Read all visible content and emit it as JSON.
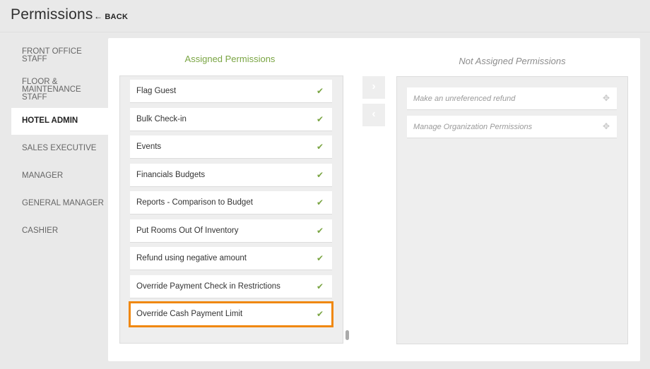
{
  "header": {
    "title": "Permissions",
    "back_label": "BACK"
  },
  "sidebar": {
    "items": [
      {
        "label": "FRONT OFFICE STAFF",
        "active": false
      },
      {
        "label": "FLOOR & MAINTENANCE STAFF",
        "active": false
      },
      {
        "label": "HOTEL ADMIN",
        "active": true
      },
      {
        "label": "SALES EXECUTIVE",
        "active": false
      },
      {
        "label": "MANAGER",
        "active": false
      },
      {
        "label": "GENERAL MANAGER",
        "active": false
      },
      {
        "label": "CASHIER",
        "active": false
      }
    ]
  },
  "assigned": {
    "title": "Assigned Permissions",
    "items": [
      "Flag Guest",
      "Bulk Check-in",
      "Events",
      "Financials Budgets",
      "Reports - Comparison to Budget",
      "Put Rooms Out Of Inventory",
      "Refund using negative amount",
      "Override Payment Check in Restrictions",
      "Override Cash Payment Limit"
    ],
    "selected": "Override Cash Payment Limit"
  },
  "not_assigned": {
    "title": "Not Assigned Permissions",
    "items": [
      "Make an unreferenced refund",
      "Manage Organization Permissions"
    ]
  },
  "controls": {
    "move_right_icon": "chevron-right-icon",
    "move_left_icon": "chevron-left-icon"
  },
  "colors": {
    "accent_green": "#7aa543",
    "highlight_orange": "#f0880f",
    "page_bg": "#e9e9e9"
  }
}
